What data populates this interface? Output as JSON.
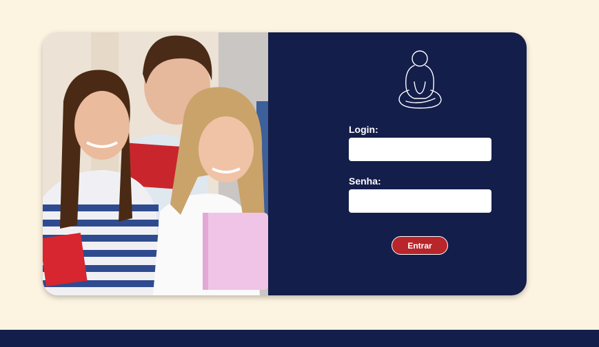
{
  "login": {
    "label": "Login:",
    "value": "",
    "placeholder": ""
  },
  "password": {
    "label": "Senha:",
    "value": "",
    "placeholder": ""
  },
  "submit_label": "Entrar",
  "colors": {
    "background": "#fdf3e1",
    "panel": "#141e4a",
    "button": "#b8252a",
    "footer": "#141e4a"
  },
  "icons": {
    "logo": "meditating-person-icon"
  }
}
